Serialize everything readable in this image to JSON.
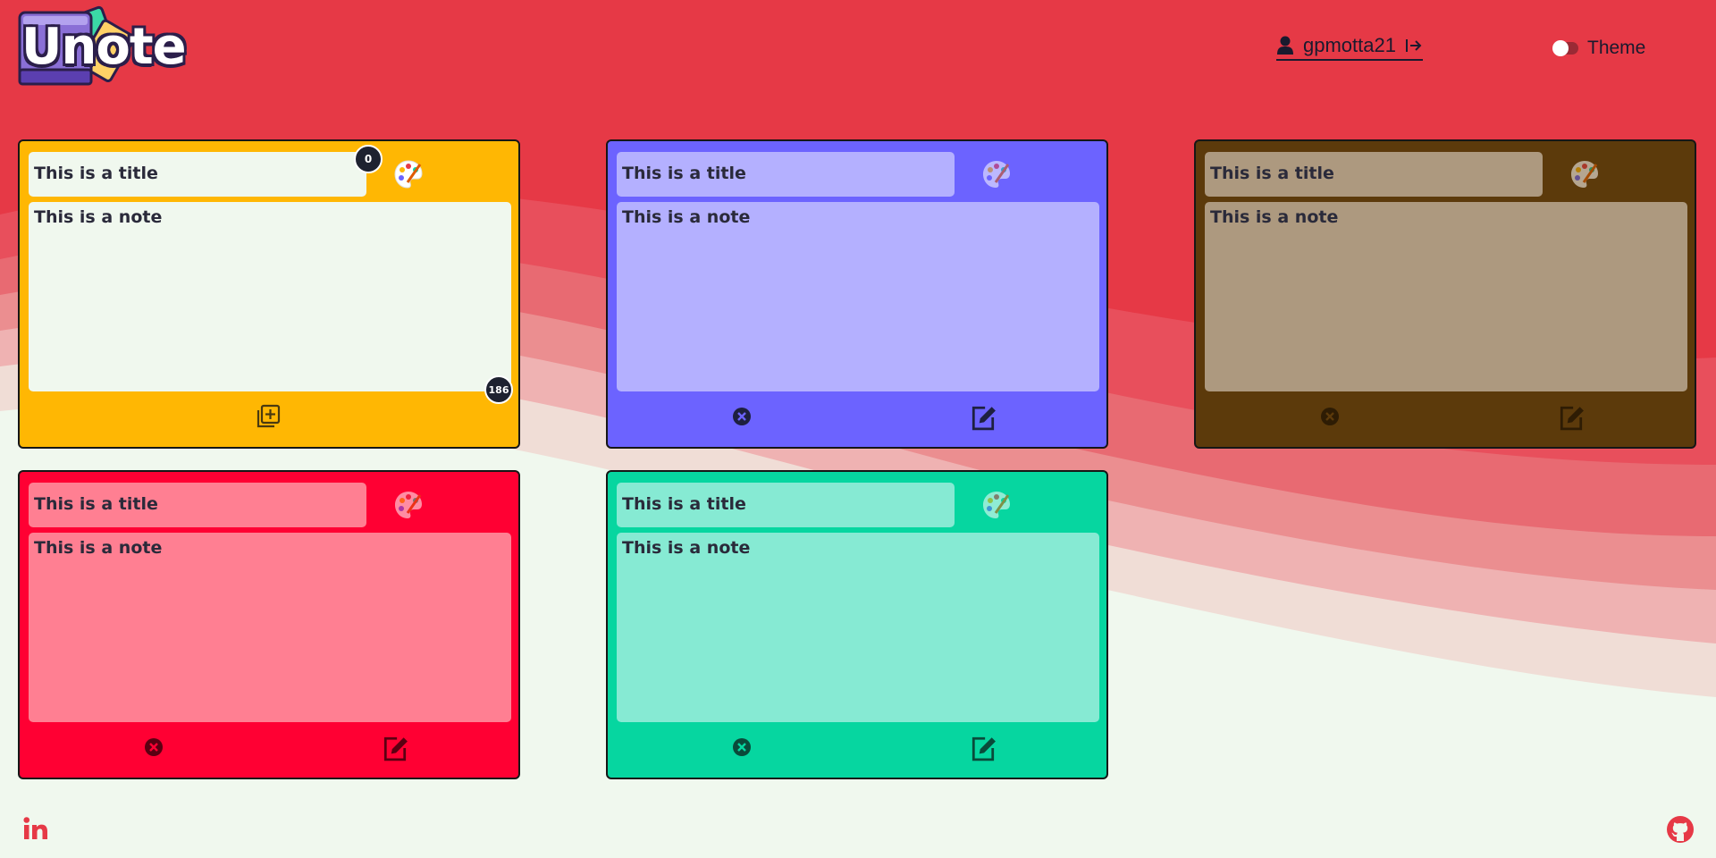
{
  "app": {
    "title": "Unote"
  },
  "header": {
    "username": "gpmotta21",
    "theme_label": "Theme"
  },
  "colors": {
    "page_bg": "#f0f8ee",
    "wave_red": "#e63946",
    "text_dark": "#2a2a3a"
  },
  "new_note": {
    "title": "This is a title",
    "note": "This is a note",
    "title_count": "0",
    "note_count": "186",
    "bg": "#ffb703",
    "field_bg": "#f0f8ee"
  },
  "notes": [
    {
      "title": "This is a title",
      "note": "This is a note",
      "bg": "#6c63ff",
      "field_bg": "#b4b0ff"
    },
    {
      "title": "This is a title",
      "note": "This is a note",
      "bg": "#5c3a0b",
      "field_bg": "#ad997f"
    },
    {
      "title": "This is a title",
      "note": "This is a note",
      "bg": "#ff0033",
      "field_bg": "#ff7f92"
    },
    {
      "title": "This is a title",
      "note": "This is a note",
      "bg": "#06d6a0",
      "field_bg": "#86ead3"
    }
  ],
  "icons": {
    "user": "user-icon",
    "logout": "logout-icon",
    "palette": "palette-icon",
    "add": "add-note-icon",
    "delete": "delete-icon",
    "edit": "edit-icon",
    "linkedin": "linkedin-icon",
    "github": "github-icon"
  }
}
